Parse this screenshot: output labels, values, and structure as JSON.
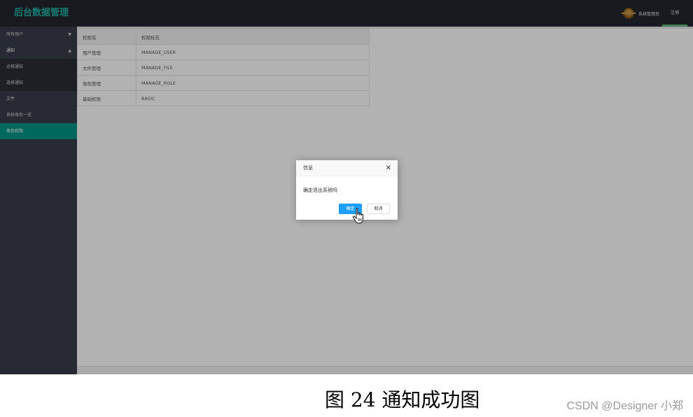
{
  "header": {
    "app_title": "后台数据管理",
    "user_name": "系统管理员",
    "logout_label": "注销"
  },
  "sidebar": {
    "items": [
      {
        "label": "所有用户",
        "caret": "▼"
      },
      {
        "label": "通知",
        "caret": "▲"
      },
      {
        "label": "必修通知"
      },
      {
        "label": "选修通知"
      },
      {
        "label": "文件"
      },
      {
        "label": "系统角色一览"
      },
      {
        "label": "角色权限"
      }
    ]
  },
  "table": {
    "headers": [
      "权限名",
      "权限标志"
    ],
    "rows": [
      [
        "用户管理",
        "MANAGE_USER"
      ],
      [
        "文件管理",
        "MANAGE_FILE"
      ],
      [
        "角色管理",
        "MANAGE_ROLE"
      ],
      [
        "基础权限",
        "BASIC"
      ]
    ]
  },
  "dialog": {
    "title": "信息",
    "close_glyph": "✕",
    "message": "确定退出系统吗",
    "ok_label": "确定",
    "cancel_label": "取消"
  },
  "caption": "图 24  通知成功图",
  "watermark": "CSDN @Designer 小郑"
}
